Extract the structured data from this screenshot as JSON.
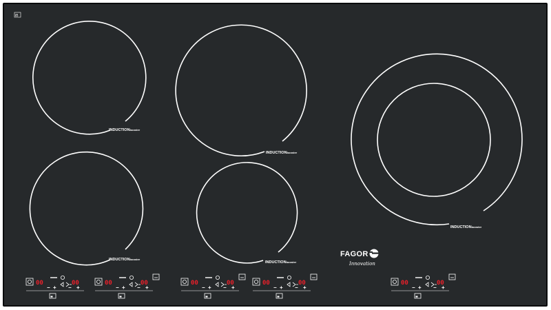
{
  "hob": {
    "zone_label_main": "INDUCTION",
    "zone_label_sub": "booster",
    "badge_text": "iB",
    "brand": "FAGOR",
    "brand_sub": "Innovation"
  },
  "controls": [
    {
      "left_display": "00",
      "right_display": "00"
    },
    {
      "left_display": "00",
      "right_display": "00"
    },
    {
      "left_display": "00",
      "right_display": "00"
    },
    {
      "left_display": "00",
      "right_display": "00"
    },
    {
      "left_display": "00",
      "right_display": "00"
    }
  ],
  "colors": {
    "glass": "#26292b",
    "frame": "#0b0c0d",
    "ring": "#ffffff",
    "display": "#e8202a"
  }
}
